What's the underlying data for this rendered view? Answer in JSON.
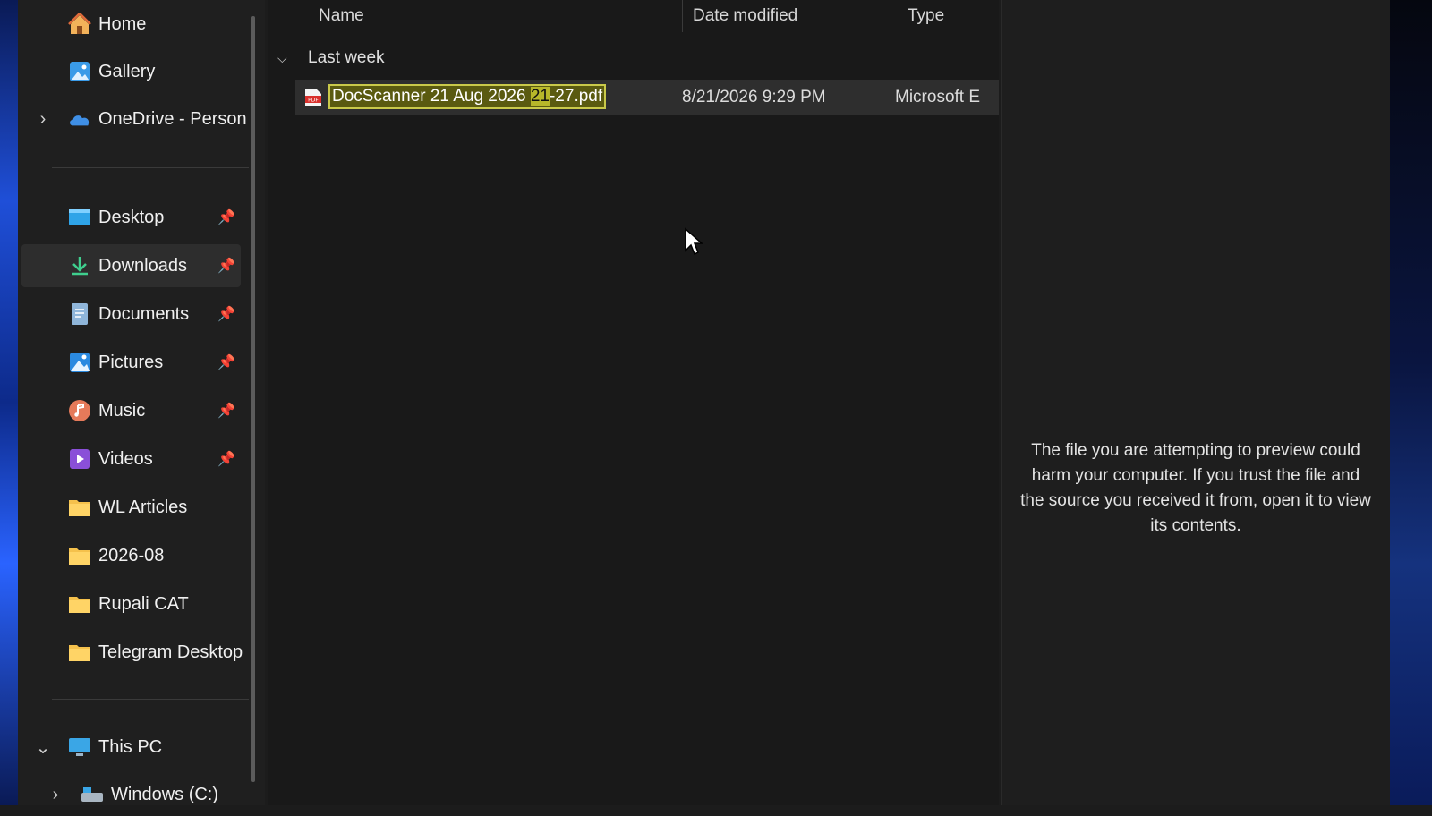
{
  "columns": {
    "name": "Name",
    "date_modified": "Date modified",
    "type": "Type"
  },
  "sidebar": {
    "items": [
      {
        "label": "Home",
        "icon": "home-icon",
        "pinned": false
      },
      {
        "label": "Gallery",
        "icon": "gallery-icon",
        "pinned": false
      },
      {
        "label": "OneDrive - Person",
        "icon": "onedrive-icon",
        "pinned": false,
        "expandable": true
      },
      {
        "label": "Desktop",
        "icon": "desktop-icon",
        "pinned": true
      },
      {
        "label": "Downloads",
        "icon": "download-icon",
        "pinned": true,
        "selected": true
      },
      {
        "label": "Documents",
        "icon": "documents-icon",
        "pinned": true
      },
      {
        "label": "Pictures",
        "icon": "pictures-icon",
        "pinned": true
      },
      {
        "label": "Music",
        "icon": "music-icon",
        "pinned": true
      },
      {
        "label": "Videos",
        "icon": "videos-icon",
        "pinned": true
      },
      {
        "label": "WL Articles",
        "icon": "folder-icon",
        "pinned": false
      },
      {
        "label": "2026-08",
        "icon": "folder-icon",
        "pinned": false
      },
      {
        "label": "Rupali CAT",
        "icon": "folder-icon",
        "pinned": false
      },
      {
        "label": "Telegram Desktop",
        "icon": "folder-icon",
        "pinned": false
      },
      {
        "label": "This PC",
        "icon": "this-pc-icon",
        "pinned": false,
        "expanded": true
      },
      {
        "label": "Windows (C:)",
        "icon": "drive-icon",
        "pinned": false,
        "expandable": true
      }
    ]
  },
  "group": {
    "label": "Last week"
  },
  "file": {
    "name_before": "DocScanner 21 Aug 2026 ",
    "name_selected": "21",
    "name_after": "-27.pdf",
    "date": "8/21/2026 9:29 PM",
    "type": "Microsoft E"
  },
  "preview": {
    "message": "The file you are attempting to preview could harm your computer. If you trust the file and the source you received it from, open it to view its contents."
  },
  "colors": {
    "rename_border": "#c9c94a",
    "rename_selection": "#b7b72a",
    "background": "#1c1c1c"
  }
}
